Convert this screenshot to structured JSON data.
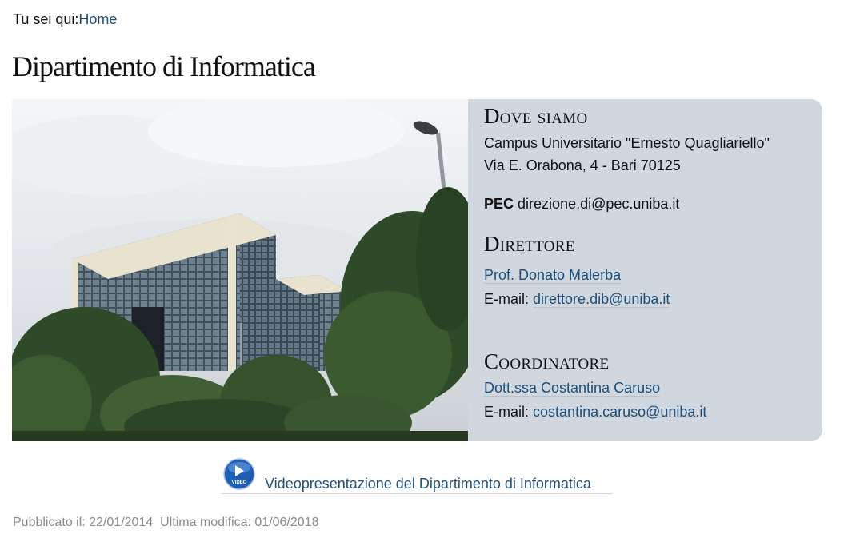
{
  "breadcrumb": {
    "prefix": "Tu sei qui:",
    "home": "Home"
  },
  "page": {
    "title": "Dipartimento di Informatica"
  },
  "info": {
    "location_heading": "Dove siamo",
    "campus": "Campus Universitario \"Ernesto Quagliariello\"",
    "address": "Via E. Orabona, 4 - Bari 70125",
    "pec_label": "PEC",
    "pec_value": "direzione.di@pec.uniba.it",
    "director_heading": "Direttore",
    "director_name": "Prof. Donato Malerba",
    "email_label": "E-mail:",
    "director_email": "direttore.dib@uniba.it",
    "coordinator_heading": "Coordinatore",
    "coordinator_name": "Dott.ssa Costantina Caruso",
    "coordinator_email": "costantina.caruso@uniba.it"
  },
  "video": {
    "icon_label": "VIDEO",
    "link": "Videopresentazione del Dipartimento di Informatica"
  },
  "meta": {
    "published": "Pubblicato il: 22/01/2014",
    "modified": "Ultima modifica: 01/06/2018"
  },
  "colors": {
    "link": "#1f4e79",
    "info_bg": "#d0d7df",
    "meta": "#8a8a8a"
  }
}
